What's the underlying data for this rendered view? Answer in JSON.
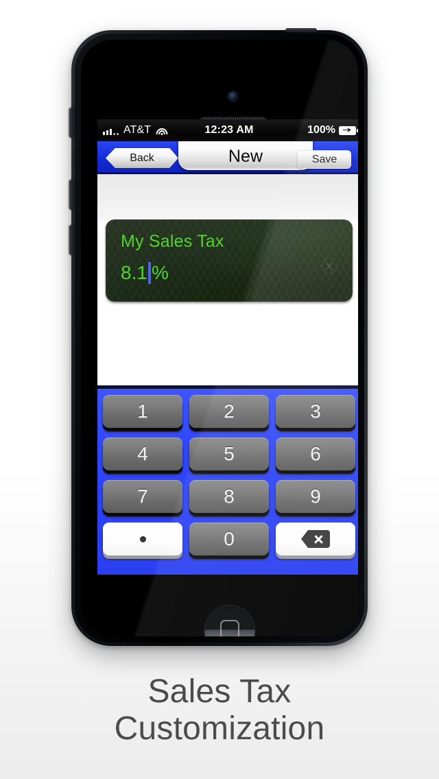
{
  "caption": {
    "line1": "Sales Tax",
    "line2": "Customization"
  },
  "status_bar": {
    "carrier": "AT&T",
    "time": "12:23 AM",
    "battery_percent": "100%",
    "signal_icon": "signal-bars-icon",
    "wifi_icon": "wifi-icon",
    "battery_icon": "battery-charging-icon"
  },
  "nav_bar": {
    "back_label": "Back",
    "title": "New",
    "save_label": "Save",
    "accent_color": "#1a32e0"
  },
  "display": {
    "label": "My Sales Tax",
    "value": "8.1",
    "unit": "%",
    "text_color": "#4fd62c",
    "caret_color": "#4a66e6",
    "clear_icon": "clear-circle-x-icon"
  },
  "keypad": {
    "background_color": "#2f46fa",
    "rows": [
      [
        {
          "key": "1",
          "name": "key-1",
          "style": "dark"
        },
        {
          "key": "2",
          "name": "key-2",
          "style": "dark"
        },
        {
          "key": "3",
          "name": "key-3",
          "style": "dark"
        }
      ],
      [
        {
          "key": "4",
          "name": "key-4",
          "style": "dark"
        },
        {
          "key": "5",
          "name": "key-5",
          "style": "dark"
        },
        {
          "key": "6",
          "name": "key-6",
          "style": "dark"
        }
      ],
      [
        {
          "key": "7",
          "name": "key-7",
          "style": "dark"
        },
        {
          "key": "8",
          "name": "key-8",
          "style": "dark"
        },
        {
          "key": "9",
          "name": "key-9",
          "style": "dark"
        }
      ],
      [
        {
          "key": ".",
          "name": "key-decimal",
          "style": "light",
          "icon": "dot-icon"
        },
        {
          "key": "0",
          "name": "key-0",
          "style": "dark"
        },
        {
          "key": "",
          "name": "key-backspace",
          "style": "light",
          "icon": "backspace-icon"
        }
      ]
    ]
  },
  "device": {
    "camera_icon": "front-camera-icon",
    "speaker_icon": "earpiece-speaker-icon",
    "home_button_icon": "home-button-icon"
  }
}
